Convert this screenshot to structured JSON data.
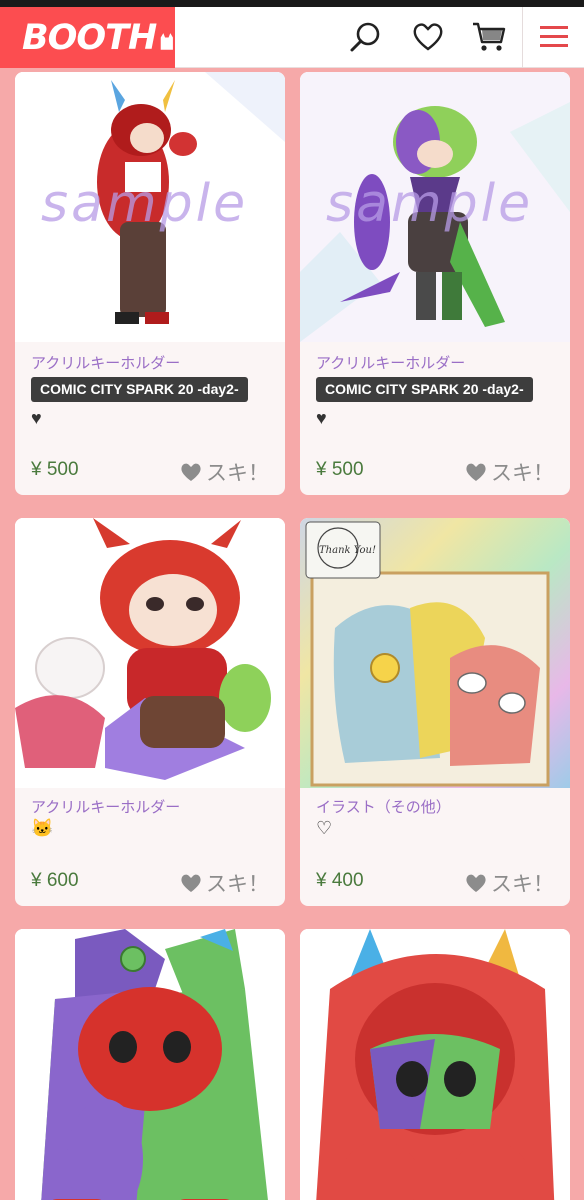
{
  "header": {
    "logo_text": "BOOTH",
    "icons": [
      "search-icon",
      "heart-icon",
      "cart-icon",
      "menu-icon"
    ]
  },
  "colors": {
    "brand": "#fc4d50",
    "price": "#4a7a3d",
    "category": "#9a6ec6",
    "background": "#f6a9a9"
  },
  "items": [
    {
      "category": "アクリルキーホルダー",
      "event": "COMIC CITY SPARK 20 -day2-",
      "note": "♥",
      "price": "¥ 500",
      "like": "スキ！",
      "watermark": "sample"
    },
    {
      "category": "アクリルキーホルダー",
      "event": "COMIC CITY SPARK 20 -day2-",
      "note": "♥",
      "price": "¥ 500",
      "like": "スキ！",
      "watermark": "sample"
    },
    {
      "category": "アクリルキーホルダー",
      "note": "🐱",
      "price": "¥ 600",
      "like": "スキ！"
    },
    {
      "category": "イラスト（その他）",
      "note": "♡",
      "price": "¥ 400",
      "like": "スキ！",
      "card_text": "Thank You!"
    },
    {
      "category": ""
    },
    {
      "category": ""
    }
  ]
}
